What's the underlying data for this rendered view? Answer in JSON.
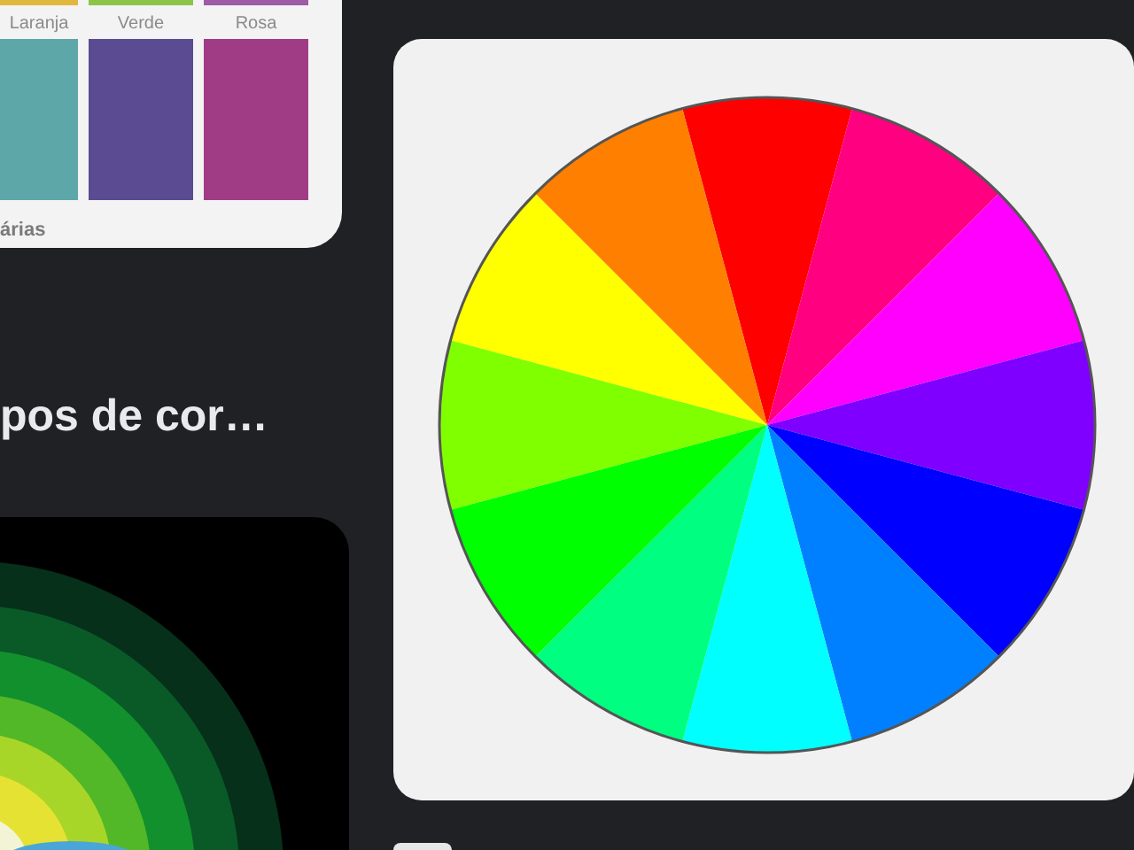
{
  "swatch_card": {
    "strips": [
      {
        "color": "#e0b840"
      },
      {
        "color": "#8cc44a"
      },
      {
        "color": "#9e5aa6"
      }
    ],
    "columns": [
      {
        "label": "Laranja",
        "color": "#5ea7a9"
      },
      {
        "label": "Verde",
        "color": "#5a4b92"
      },
      {
        "label": "Rosa",
        "color": "#a03c86"
      }
    ],
    "caption": "árias"
  },
  "result_title": "pos de cor…"
}
